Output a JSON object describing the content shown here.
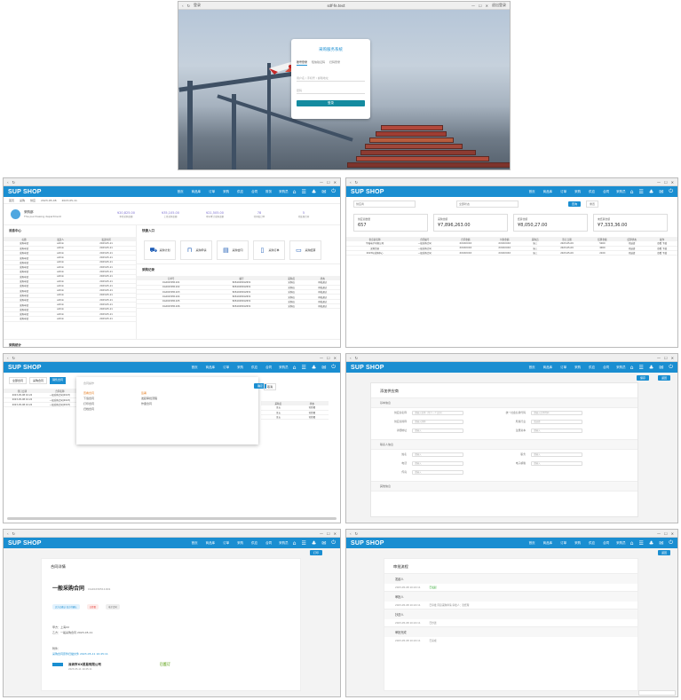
{
  "browser": {
    "login_tab": "登录",
    "address": "sdf-fe.test",
    "controls": [
      "—",
      "☐",
      "✕"
    ],
    "right_label": "退出登录"
  },
  "login": {
    "title": "采购服务系统",
    "tabs": [
      "账号登录",
      "短信验证码",
      "扫码登录"
    ],
    "user_ph": "用户名 / 手机号 / 邮箱地址",
    "pwd_ph": "密码",
    "button": "登录"
  },
  "app": {
    "logo": "SUP SHOP",
    "menu": [
      "首页",
      "商品库",
      "订单",
      "采购",
      "供应",
      "合同",
      "财务",
      "Admin",
      "更多"
    ],
    "user": "采购员",
    "accent": "#1a8ed1"
  },
  "dashboard": {
    "crumbs": [
      "首页",
      "采购",
      "供应",
      "2023-05-08",
      "2023-05-11"
    ],
    "dept_name": "采购部",
    "dept_en": "The purchasing department",
    "stats": [
      {
        "value": "¥20,825.00",
        "label": "本月采购金额"
      },
      {
        "value": "¥35,105.00",
        "label": "上月采购金额"
      },
      {
        "value": "¥21,505.00",
        "label": "本年累计采购金额"
      },
      {
        "value": "78",
        "label": "待审批订单"
      },
      {
        "value": "5",
        "label": "待处理合同"
      }
    ],
    "msg_title": "消息中心",
    "msg_cols": [
      "标题",
      "发送人",
      "发送时间"
    ],
    "msg_rows": [
      [
        "采购申请",
        "admin",
        "2023-05-11"
      ],
      [
        "采购申请",
        "admin",
        "2023-05-11"
      ],
      [
        "采购申请",
        "admin",
        "2023-05-11"
      ],
      [
        "采购申请",
        "admin",
        "2023-05-11"
      ],
      [
        "采购申请",
        "admin",
        "2023-05-11"
      ],
      [
        "采购申请",
        "admin",
        "2023-05-11"
      ],
      [
        "采购申请",
        "admin",
        "2023-05-11"
      ],
      [
        "采购申请",
        "admin",
        "2023-05-11"
      ],
      [
        "采购申请",
        "admin",
        "2023-05-11"
      ],
      [
        "采购申请",
        "admin",
        "2023-05-11"
      ],
      [
        "采购申请",
        "admin",
        "2023-05-11"
      ],
      [
        "采购申请",
        "admin",
        "2023-05-11"
      ],
      [
        "采购申请",
        "admin",
        "2023-05-11"
      ],
      [
        "采购申请",
        "admin",
        "2023-05-11"
      ],
      [
        "采购申请",
        "admin",
        "2023-05-11"
      ],
      [
        "采购申请",
        "admin",
        "2023-05-11"
      ],
      [
        "采购申请",
        "admin",
        "2023-05-11"
      ]
    ],
    "quick_title": "快捷入口",
    "quick": [
      "采购计划",
      "采购申请",
      "采购合同",
      "采购订单",
      "采购结算"
    ],
    "record_title": "采购记录",
    "record_cols": [
      "订单号",
      "编号",
      "采购员",
      "状态"
    ],
    "record_rows": [
      [
        "CG2023051101",
        "8261028012631",
        "采购员",
        "审批通过"
      ],
      [
        "CG2023051102",
        "8261028012631",
        "采购员",
        "审批通过"
      ],
      [
        "CG2023051103",
        "8261028012631",
        "采购员",
        "审批通过"
      ],
      [
        "CG2023051104",
        "8261028012631",
        "采购员",
        "审批通过"
      ],
      [
        "CG2023051105",
        "8261028012631",
        "采购员",
        "审批通过"
      ],
      [
        "CG2023051106",
        "8261028012631",
        "采购员",
        "审批通过"
      ]
    ],
    "footer_title": "采购统计"
  },
  "report": {
    "filters": [
      "供应商",
      "全部状态"
    ],
    "search": "查询",
    "reset": "重置",
    "sums": [
      {
        "label": "供应商数量",
        "value": "657"
      },
      {
        "label": "采购金额",
        "value": "¥7,896,263.00"
      },
      {
        "label": "结算金额",
        "value": "¥8,050,27.00"
      },
      {
        "label": "未结算金额",
        "value": "¥7,333,36.00"
      }
    ],
    "cols": [
      "供应商名称",
      "合同编号",
      "合同金额",
      "付款金额",
      "采购员",
      "签订日期",
      "结算金额",
      "结算状态",
      "操作"
    ],
    "rows": [
      [
        "华强电子有限公司",
        "一般采购合同",
        "XXXXXXXX",
        "XXXXXXXX",
        "张三",
        "2023-05-09",
        "5000",
        "已结清",
        "查看 下载"
      ],
      [
        "深圳贸易",
        "一般采购合同",
        "XXXXXXXX",
        "XXXXXXXX",
        "张三",
        "2023-05-09",
        "4000",
        "已结清",
        "查看 下载"
      ],
      [
        "2023年采购中心",
        "一般采购合同",
        "XXXXXXXX",
        "XXXXXXXX",
        "张三",
        "2023-05-09",
        "2100",
        "已结清",
        "查看 下载"
      ]
    ]
  },
  "contracts": {
    "tabs": [
      "全部合同",
      "采购合同",
      "销售合同"
    ],
    "cols": [
      "签订日期",
      "合同名称"
    ],
    "rows": [
      [
        "2023-05-08 10:24",
        "一般采购合同(2023)"
      ],
      [
        "2023-05-08 10:24",
        "一般采购合同(2023)"
      ],
      [
        "2023-05-08 10:24",
        "一般采购合同(2023)"
      ]
    ],
    "right_cols": [
      "采购员",
      "状态"
    ],
    "right_rows": [
      [
        "王五",
        "已签署"
      ],
      [
        "王五",
        "已签署"
      ],
      [
        "王五",
        "已签署"
      ]
    ],
    "popup_title": "合同操作",
    "popup_items": [
      "查看合同",
      "下载合同",
      "打印合同",
      "归档合同"
    ],
    "popup_right": [
      "签署",
      "发起审批流程",
      "作废合同"
    ],
    "confirm": "确定",
    "cancel": "取消"
  },
  "supplier": {
    "title": "添加供应商",
    "save": "保存",
    "back": "返回",
    "sec1": "基本信息",
    "sec2": "联系人信息",
    "sec3": "其他信息",
    "fields1": [
      {
        "label": "供应商名称",
        "ph": "请输入名称（至少一个汉字）"
      },
      {
        "label": "统一社会信用代码",
        "ph": "请输入信用代码"
      },
      {
        "label": "供应商简称",
        "ph": "请输入简称"
      },
      {
        "label": "所属行业",
        "ph": "请选择"
      },
      {
        "label": "详细地址",
        "ph": "请输入"
      },
      {
        "label": "注册资本",
        "ph": "请输入"
      }
    ],
    "fields2": [
      {
        "label": "姓名",
        "ph": "请输入"
      },
      {
        "label": "职务",
        "ph": "请输入"
      },
      {
        "label": "电话",
        "ph": "请输入"
      },
      {
        "label": "电子邮箱",
        "ph": "请输入"
      },
      {
        "label": "传真",
        "ph": "请输入"
      }
    ]
  },
  "contract_detail": {
    "title": "合同详情",
    "name": "一般采购合同",
    "code": "CG20230511001",
    "tags": [
      "买方已确认 卖方待确认",
      "已签署",
      "电子合同"
    ],
    "party_a": "甲方：上海XX",
    "party_b": "乙方：一般采购合同 2023-05-11",
    "item_title": "附件：",
    "item_text": "采购合同原件扫描文件 2023-05-11 10:45:11",
    "company": "深圳市XX贸易有限公司",
    "company_sub": "2023-05-11 10:45:11",
    "pass": "已签订",
    "button": "打印"
  },
  "tracking": {
    "title": "审批流程",
    "sections": [
      "发起人",
      "审批人",
      "抄送人",
      "审批完成"
    ],
    "lines": [
      [
        "2023-05-08 10:24:11",
        "已发起"
      ],
      [
        "2023-05-08 10:24:11",
        "已审批 同意采购申请 审批人：张经理"
      ],
      [
        "2023-05-08 10:24:11",
        "已抄送"
      ],
      [
        "2023-05-08 10:24:11",
        "已完成"
      ]
    ],
    "button": "返回"
  }
}
